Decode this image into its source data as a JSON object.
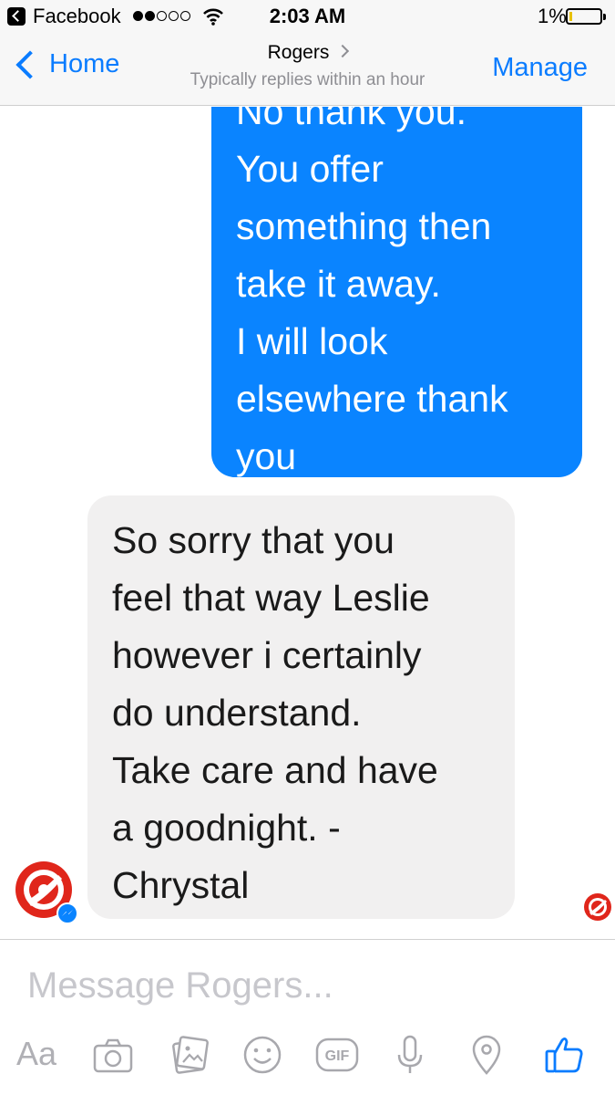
{
  "status_bar": {
    "carrier_app": "Facebook",
    "time": "2:03 AM",
    "battery": "1%",
    "battery_level": 0.01
  },
  "nav": {
    "back_label": "Home",
    "title": "Rogers",
    "subtitle": "Typically replies within an hour",
    "manage_label": "Manage"
  },
  "messages": [
    {
      "direction": "outgoing",
      "lines": [
        "No thank you.",
        "You offer",
        "something then",
        "take it away.",
        "I will look",
        "elsewhere thank",
        "you"
      ]
    },
    {
      "direction": "incoming",
      "lines": [
        "So sorry that you",
        "feel that way Leslie",
        "however i certainly",
        "do understand.",
        "Take care and have",
        "a goodnight. -",
        "Chrystal"
      ]
    }
  ],
  "composer": {
    "placeholder": "Message Rogers...",
    "aa_label": "Aa",
    "gif_label": "GIF"
  },
  "colors": {
    "accent": "#0a7cff",
    "outgoing_bubble": "#0a84ff",
    "incoming_bubble": "#f1f0f0",
    "brand_red": "#e0261b"
  },
  "icons": [
    "camera-icon",
    "photo-gallery-icon",
    "emoji-icon",
    "gif-icon",
    "microphone-icon",
    "location-icon",
    "like-icon"
  ]
}
